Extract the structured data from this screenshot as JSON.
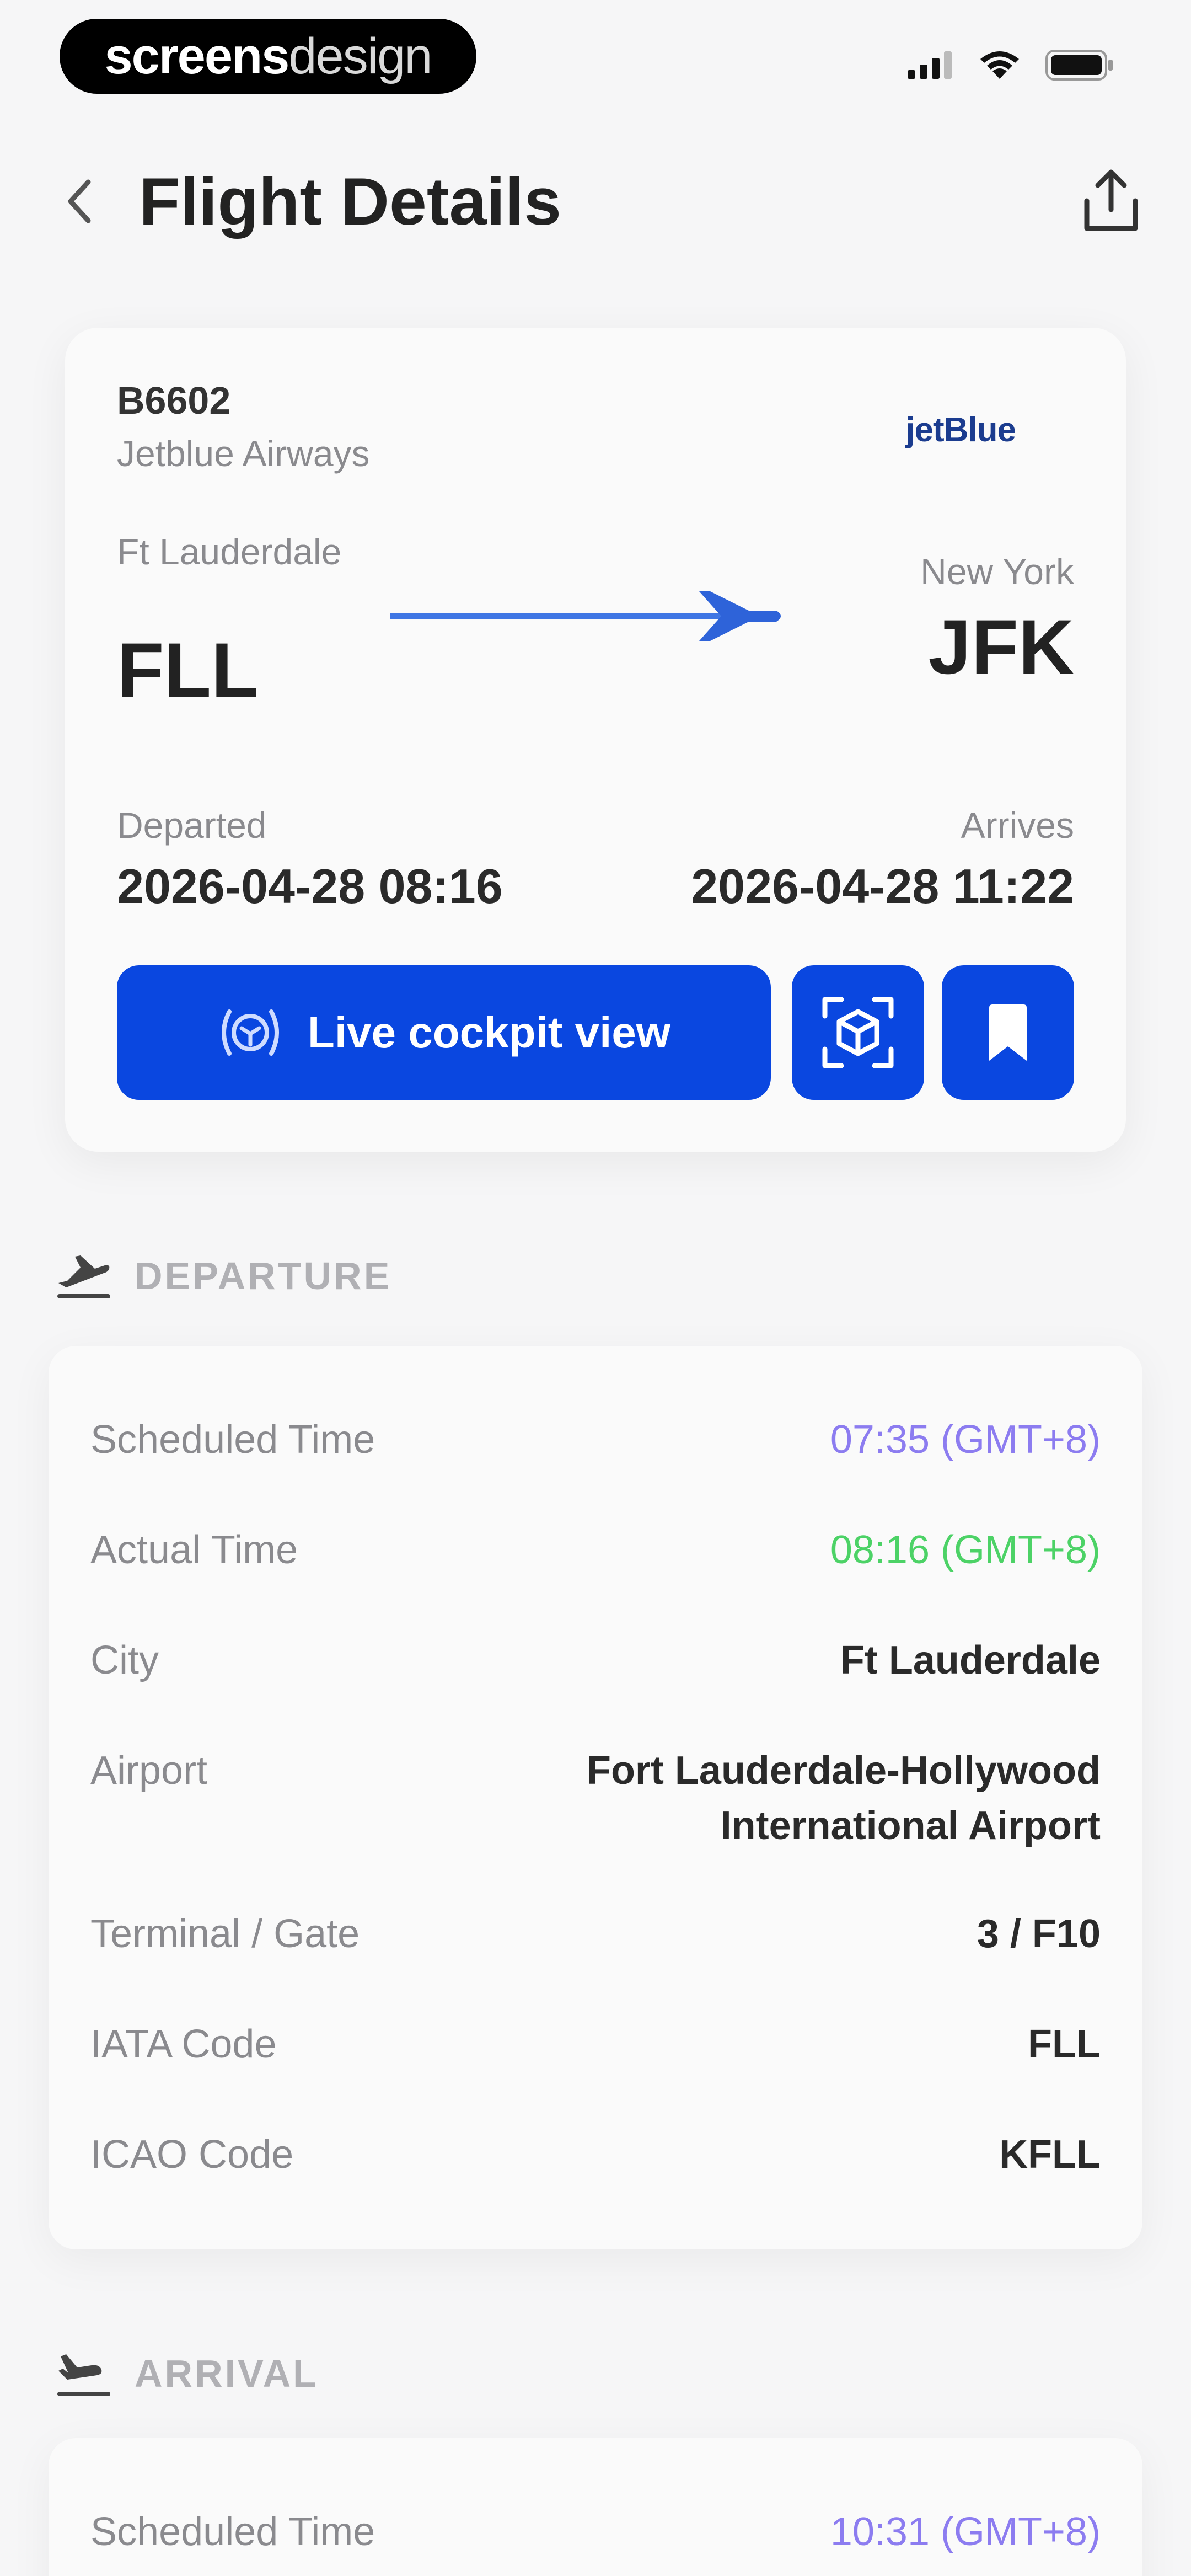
{
  "status_bar": {
    "brand_bold": "screens",
    "brand_light": "design",
    "icons": [
      "signal-icon",
      "wifi-icon",
      "battery-icon"
    ]
  },
  "header": {
    "title": "Flight Details",
    "back_icon": "chevron-left-icon",
    "share_icon": "share-icon"
  },
  "flight": {
    "number": "B6602",
    "airline": "Jetblue Airways",
    "airline_logo": "jetBlue",
    "origin_city": "Ft Lauderdale",
    "origin_code": "FLL",
    "dest_city": "New York",
    "dest_code": "JFK",
    "departed_label": "Departed",
    "departed_value": "2026-04-28 08:16",
    "arrives_label": "Arrives",
    "arrives_value": "2026-04-28 11:22",
    "live_button_label": "Live cockpit view",
    "accent_color": "#0a47e0"
  },
  "departure": {
    "section_title": "DEPARTURE",
    "rows": [
      {
        "label": "Scheduled Time",
        "value": "07:35 (GMT+8)"
      },
      {
        "label": "Actual Time",
        "value": "08:16 (GMT+8)"
      },
      {
        "label": "City",
        "value": "Ft Lauderdale"
      },
      {
        "label": "Airport",
        "value": "Fort Lauderdale-Hollywood International Airport"
      },
      {
        "label": "Terminal / Gate",
        "value": "3 / F10"
      },
      {
        "label": "IATA Code",
        "value": "FLL"
      },
      {
        "label": "ICAO Code",
        "value": "KFLL"
      }
    ],
    "scheduled_color": "#8c7cf0",
    "actual_color": "#4cd266"
  },
  "arrival": {
    "section_title": "ARRIVAL",
    "rows": [
      {
        "label": "Scheduled Time",
        "value": "10:31 (GMT+8)"
      }
    ]
  }
}
